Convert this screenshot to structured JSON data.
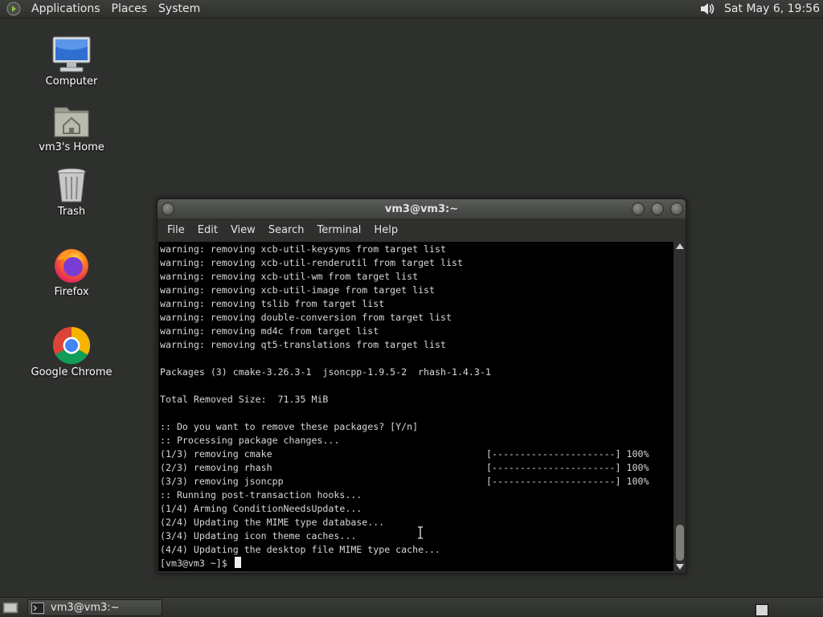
{
  "top_panel": {
    "menus": [
      "Applications",
      "Places",
      "System"
    ],
    "clock": "Sat May  6, 19:56",
    "icons": {
      "logo": "gnome-foot-icon",
      "volume": "volume-icon"
    }
  },
  "desktop": {
    "icons": [
      {
        "label": "Computer",
        "icon": "computer-icon"
      },
      {
        "label": "vm3's Home",
        "icon": "home-folder-icon"
      },
      {
        "label": "Trash",
        "icon": "trash-icon"
      },
      {
        "label": "Firefox",
        "icon": "firefox-icon"
      },
      {
        "label": "Google Chrome",
        "icon": "chrome-icon"
      }
    ]
  },
  "terminal": {
    "title": "vm3@vm3:~",
    "menu": [
      "File",
      "Edit",
      "View",
      "Search",
      "Terminal",
      "Help"
    ],
    "lines": [
      "warning: removing xcb-util-keysyms from target list",
      "warning: removing xcb-util-renderutil from target list",
      "warning: removing xcb-util-wm from target list",
      "warning: removing xcb-util-image from target list",
      "warning: removing tslib from target list",
      "warning: removing double-conversion from target list",
      "warning: removing md4c from target list",
      "warning: removing qt5-translations from target list",
      "",
      "Packages (3) cmake-3.26.3-1  jsoncpp-1.9.5-2  rhash-1.4.3-1",
      "",
      "Total Removed Size:  71.35 MiB",
      "",
      ":: Do you want to remove these packages? [Y/n]",
      ":: Processing package changes..."
    ],
    "progress_lines": [
      {
        "text": "(1/3) removing cmake",
        "bar": "[----------------------] 100%"
      },
      {
        "text": "(2/3) removing rhash",
        "bar": "[----------------------] 100%"
      },
      {
        "text": "(3/3) removing jsoncpp",
        "bar": "[----------------------] 100%"
      }
    ],
    "hook_lines": [
      ":: Running post-transaction hooks...",
      "(1/4) Arming ConditionNeedsUpdate...",
      "(2/4) Updating the MIME type database...",
      "(3/4) Updating icon theme caches...",
      "(4/4) Updating the desktop file MIME type cache..."
    ],
    "prompt": "[vm3@vm3 ~]$ "
  },
  "bottom_panel": {
    "task_label": "vm3@vm3:~"
  },
  "colors": {
    "desktop_bg": "#2e302d",
    "terminal_bg": "#000000",
    "terminal_fg": "#d8d8d8"
  }
}
